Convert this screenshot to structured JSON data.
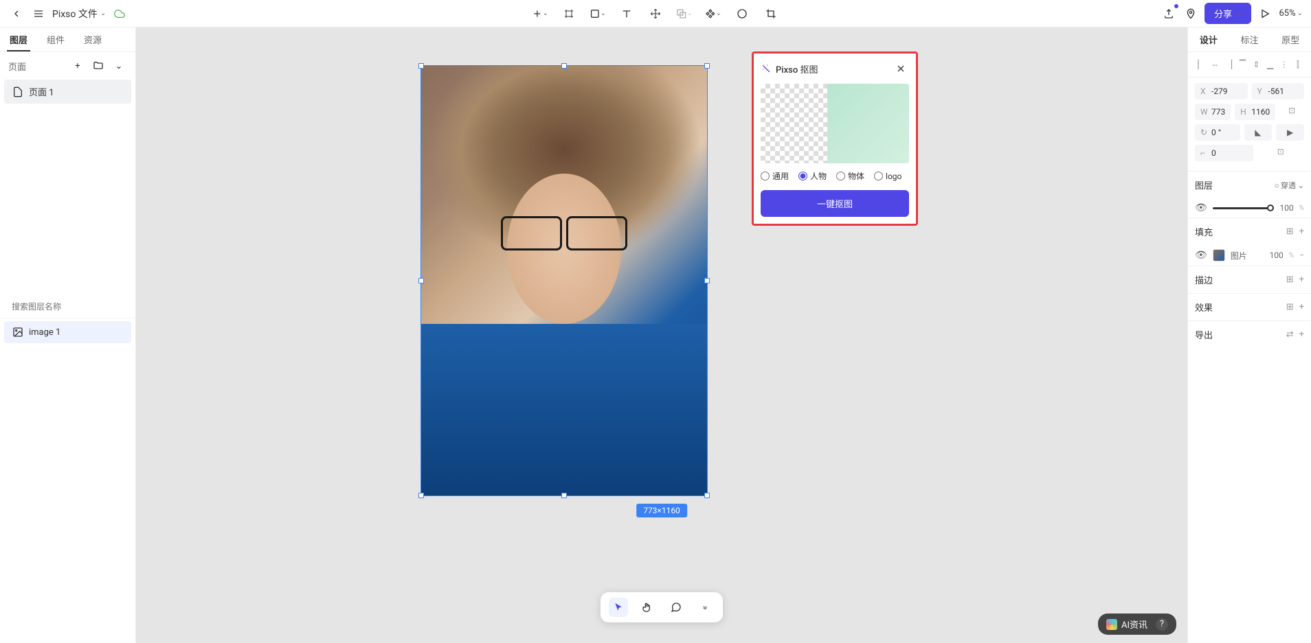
{
  "header": {
    "file_name": "Pixso 文件",
    "share_label": "分享",
    "zoom": "65%"
  },
  "left_panel": {
    "tabs": [
      "图层",
      "组件",
      "资源"
    ],
    "pages_label": "页面",
    "page1": "页面 1",
    "search_placeholder": "搜索图层名称",
    "layer1": "image 1"
  },
  "canvas": {
    "dimensions": "773×1160"
  },
  "cutout": {
    "title": "Pixso 抠图",
    "options": {
      "general": "通用",
      "person": "人物",
      "object": "物体",
      "logo": "logo"
    },
    "button": "一键抠图"
  },
  "right_panel": {
    "tabs": [
      "设计",
      "标注",
      "原型"
    ],
    "x": "-279",
    "y": "-561",
    "w": "773",
    "h": "1160",
    "rotation": "0 °",
    "radius": "0",
    "layer_section": "图层",
    "passthrough": "穿透",
    "opacity": "100",
    "fill_section": "填充",
    "fill_type": "图片",
    "fill_opacity": "100",
    "stroke_section": "描边",
    "effect_section": "效果",
    "export_section": "导出"
  },
  "watermark": "AI资讯"
}
